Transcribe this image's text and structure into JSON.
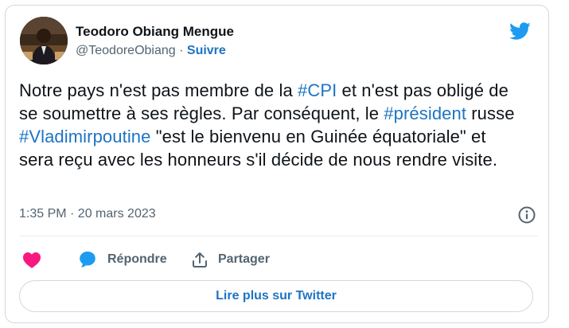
{
  "author": {
    "name": "Teodoro Obiang Mengue",
    "handle": "@TeodoreObiang",
    "separator": "·",
    "follow_label": "Suivre"
  },
  "tweet": {
    "segments": [
      {
        "text": "Notre pays n'est pas membre de la ",
        "type": "text"
      },
      {
        "text": "#CPI",
        "type": "hashtag"
      },
      {
        "text": " et n'est pas obligé de se soumettre à ses règles.  Par conséquent, le ",
        "type": "text"
      },
      {
        "text": "#président",
        "type": "hashtag"
      },
      {
        "text": " russe ",
        "type": "text"
      },
      {
        "text": "#Vladimirpoutine",
        "type": "hashtag"
      },
      {
        "text": " \"est le bienvenu en Guinée équatoriale\" et sera reçu avec les honneurs s'il décide de nous rendre visite.",
        "type": "text"
      }
    ],
    "timestamp": "1:35 PM · 20 mars 2023"
  },
  "actions": {
    "like_icon": "heart-icon",
    "reply_icon": "speech-bubble-icon",
    "reply_label": "Répondre",
    "share_icon": "share-upload-icon",
    "share_label": "Partager"
  },
  "footer": {
    "read_more_label": "Lire plus sur Twitter"
  },
  "colors": {
    "link": "#1d74c4",
    "twitter_blue": "#1d9bf0",
    "like_pink": "#f91880",
    "secondary_text": "#536471",
    "border": "#cfd9de"
  }
}
